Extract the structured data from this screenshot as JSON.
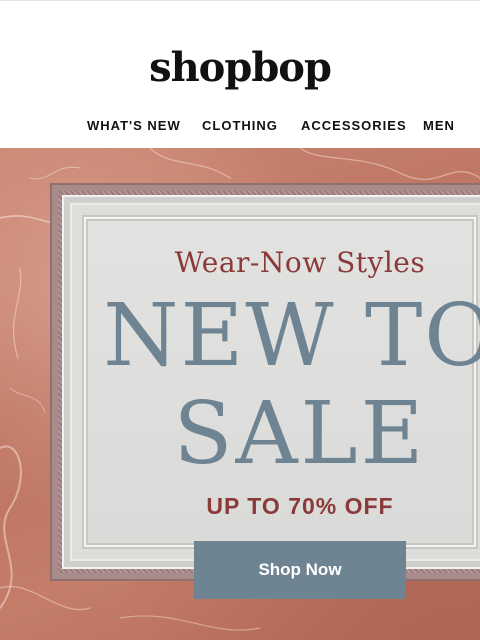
{
  "header": {
    "logo": "shopbop"
  },
  "nav": {
    "items": [
      "WHAT'S NEW",
      "CLOTHING",
      "ACCESSORIES",
      "MEN"
    ]
  },
  "hero": {
    "eyebrow": "Wear-Now Styles",
    "headline_line1": "NEW TO",
    "headline_line2": "SALE",
    "offer": "UP TO 70% OFF",
    "cta_label": "Shop Now"
  },
  "colors": {
    "headline": "#6f8493",
    "accent_red": "#8b3a3a",
    "cta_bg": "#6f8493",
    "marble": "#c47d69"
  }
}
